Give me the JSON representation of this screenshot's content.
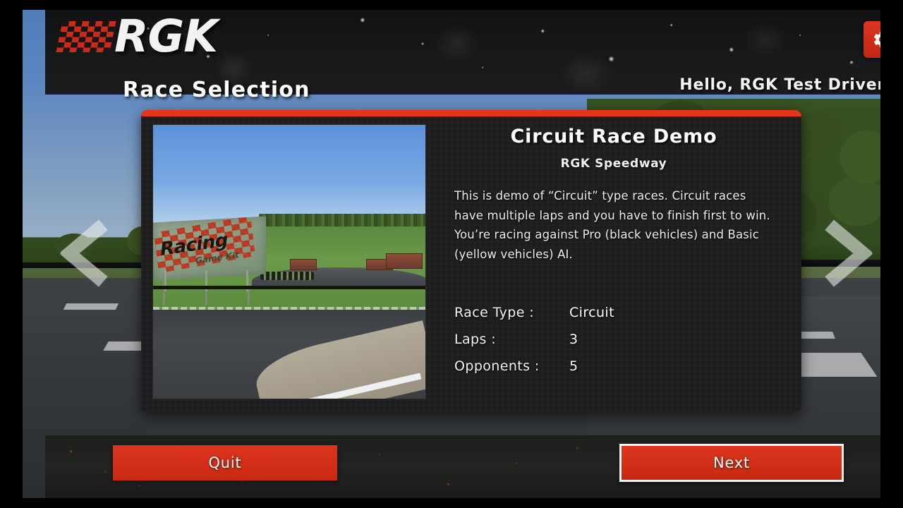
{
  "header": {
    "brand": "RGK",
    "page_title": "Race Selection",
    "greeting": "Hello,  RGK Test Driver!",
    "settings_icon": "gear-icon",
    "logo_icon": "checkered-flag-icon"
  },
  "nav": {
    "prev_icon": "chevron-left-icon",
    "next_icon": "chevron-right-icon"
  },
  "card": {
    "title": "Circuit Race Demo",
    "subtitle": "RGK Speedway",
    "description": "This is demo of “Circuit” type races. Circuit races have multiple laps and you have to finish first to win. You’re racing against Pro (black vehicles) and Basic (yellow vehicles) AI.",
    "preview": {
      "billboard_title": "Racing",
      "billboard_subtitle": "Game Kit"
    },
    "specs": [
      {
        "label": "Race Type :",
        "value": "Circuit"
      },
      {
        "label": "Laps :",
        "value": "3"
      },
      {
        "label": "Opponents :",
        "value": "5"
      }
    ]
  },
  "actions": {
    "quit_label": "Quit",
    "next_label": "Next"
  },
  "colors": {
    "accent_red": "#e8341c",
    "button_red": "#d32a18",
    "panel_dark": "#1e1e1e",
    "text_white": "#ffffff"
  }
}
